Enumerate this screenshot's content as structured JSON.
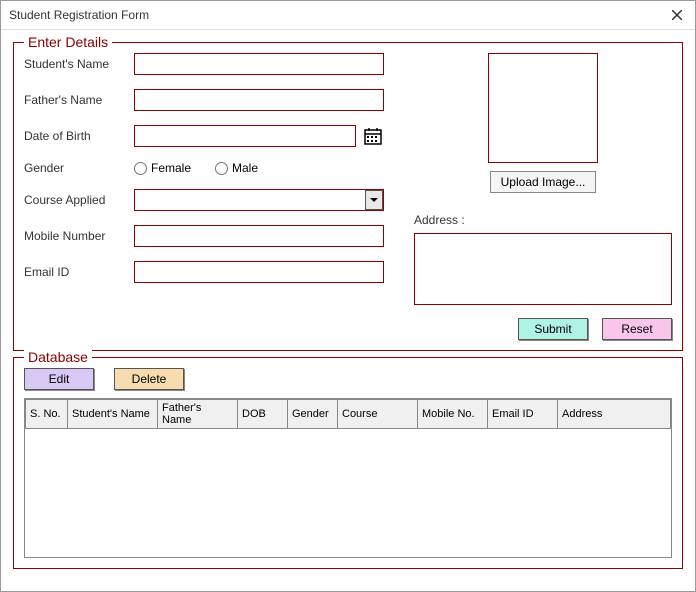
{
  "window": {
    "title": "Student Registration Form"
  },
  "details": {
    "legend": "Enter Details",
    "labels": {
      "student_name": "Student's Name",
      "father_name": "Father's Name",
      "dob": "Date of Birth",
      "gender": "Gender",
      "course": "Course Applied",
      "mobile": "Mobile Number",
      "email": "Email ID",
      "address": "Address :"
    },
    "values": {
      "student_name": "",
      "father_name": "",
      "dob": "",
      "course": "",
      "mobile": "",
      "email": "",
      "address": ""
    },
    "gender_options": {
      "female": "Female",
      "male": "Male"
    },
    "upload_label": "Upload Image...",
    "submit_label": "Submit",
    "reset_label": "Reset"
  },
  "database": {
    "legend": "Database",
    "edit_label": "Edit",
    "delete_label": "Delete",
    "columns": {
      "sno": "S. No.",
      "sname": "Student's Name",
      "fname": "Father's Name",
      "dob": "DOB",
      "gender": "Gender",
      "course": "Course",
      "mobile": "Mobile No.",
      "email": "Email ID",
      "address": "Address"
    },
    "rows": []
  }
}
